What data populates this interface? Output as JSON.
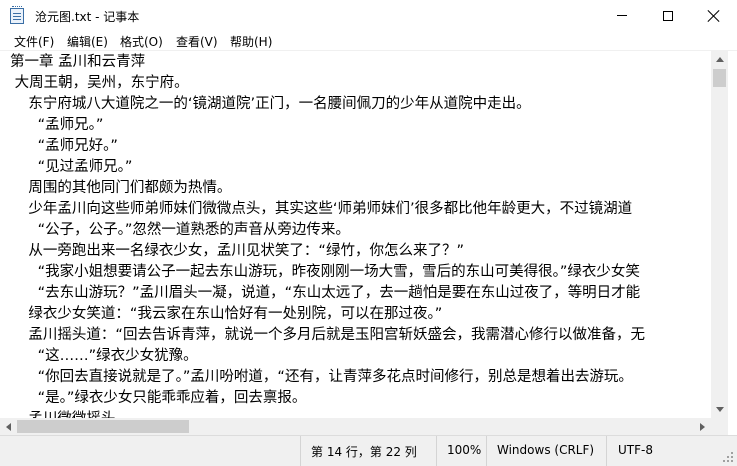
{
  "window": {
    "title": "沧元图.txt - 记事本"
  },
  "icons": {
    "app": "notepad-icon",
    "minimize": "minimize-icon",
    "maximize": "maximize-icon",
    "close": "close-icon"
  },
  "menu": {
    "file": "文件(F)",
    "edit": "编辑(E)",
    "format": "格式(O)",
    "view": "查看(V)",
    "help": "帮助(H)"
  },
  "document": {
    "lines": [
      "第一章 孟川和云青萍",
      " 大周王朝，吴州，东宁府。",
      "    东宁府城八大道院之一的‘镜湖道院’正门，一名腰间佩刀的少年从道院中走出。",
      "      “孟师兄。”",
      "      “孟师兄好。”",
      "      “见过孟师兄。”",
      "    周围的其他同门们都颇为热情。",
      "    少年孟川向这些师弟师妹们微微点头，其实这些‘师弟师妹们’很多都比他年龄更大，不过镜湖道",
      "      “公子，公子。”忽然一道熟悉的声音从旁边传来。",
      "    从一旁跑出来一名绿衣少女，孟川见状笑了：“绿竹，你怎么来了？”",
      "      “我家小姐想要请公子一起去东山游玩，昨夜刚刚一场大雪，雪后的东山可美得很。”绿衣少女笑",
      "      “去东山游玩？”孟川眉头一凝，说道，“东山太远了，去一趟怕是要在东山过夜了，等明日才能",
      "    绿衣少女笑道：“我云家在东山恰好有一处别院，可以在那过夜。”",
      "    孟川摇头道：“回去告诉青萍，就说一个多月后就是玉阳宫斩妖盛会，我需潜心修行以做准备，无",
      "      “这……”绿衣少女犹豫。",
      "      “你回去直接说就是了。”孟川吩咐道，“还有，让青萍多花点时间修行，别总是想着出去游玩。",
      "      “是。”绿衣少女只能乖乖应着，回去禀报。",
      "    孟川微微摇头。"
    ]
  },
  "status": {
    "position": "第 14 行，第 22 列",
    "zoom": "100%",
    "line_ending": "Windows (CRLF)",
    "encoding": "UTF-8"
  }
}
